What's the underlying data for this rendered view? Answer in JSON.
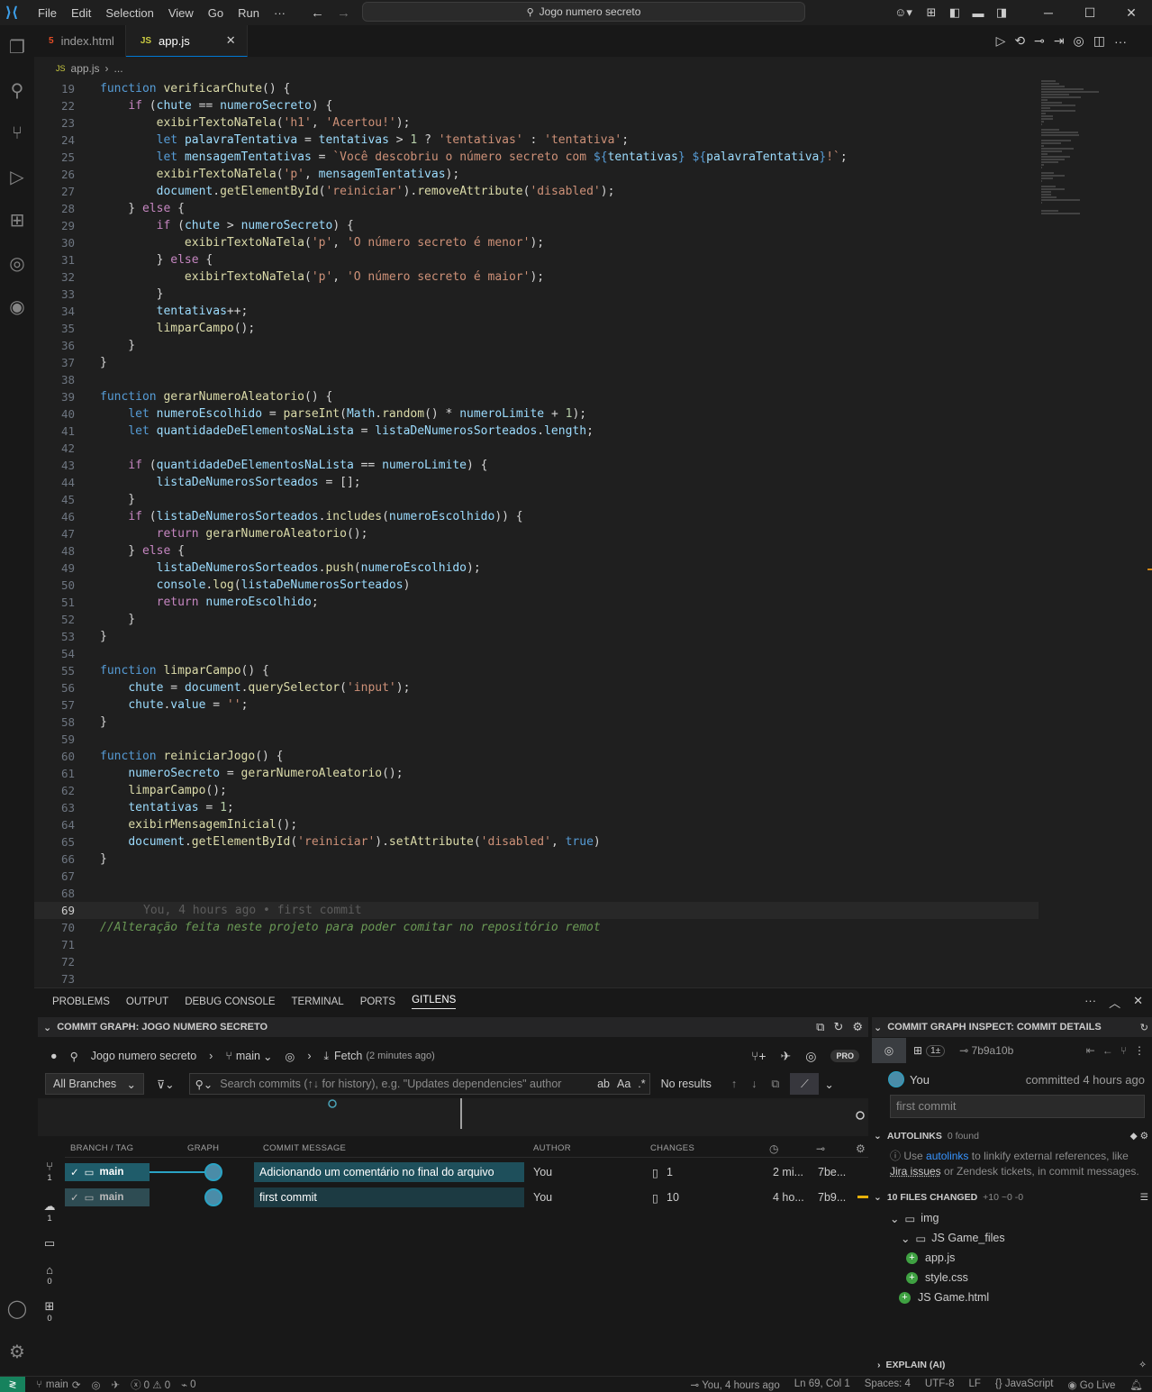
{
  "titlebar": {
    "menu": [
      "File",
      "Edit",
      "Selection",
      "View",
      "Go",
      "Run",
      "···"
    ],
    "search": "Jogo numero secreto"
  },
  "tabs": [
    {
      "label": "index.html",
      "type": "html",
      "active": false
    },
    {
      "label": "app.js",
      "type": "js",
      "active": true
    }
  ],
  "breadcrumb": {
    "file": "app.js",
    "rest": "..."
  },
  "editor": {
    "sticky_line": "19",
    "lines": [
      {
        "n": "19",
        "html": "<span class='kw'>function</span> <span class='fn'>verificarChute</span>() {"
      },
      {
        "n": "22",
        "html": "    <span class='ctl'>if</span> (<span class='var'>chute</span> == <span class='var'>numeroSecreto</span>) {"
      },
      {
        "n": "23",
        "html": "        <span class='fn'>exibirTextoNaTela</span>(<span class='str'>'h1'</span>, <span class='str'>'Acertou!'</span>);"
      },
      {
        "n": "24",
        "html": "        <span class='kw'>let</span> <span class='var'>palavraTentativa</span> = <span class='var'>tentativas</span> &gt; <span class='num'>1</span> ? <span class='str'>'tentativas'</span> : <span class='str'>'tentativa'</span>;"
      },
      {
        "n": "25",
        "html": "        <span class='kw'>let</span> <span class='var'>mensagemTentativas</span> = <span class='str'>`Você descobriu o número secreto com </span><span class='kw'>${</span><span class='var'>tentativas</span><span class='kw'>}</span> <span class='kw'>${</span><span class='var'>palavraTentativa</span><span class='kw'>}</span><span class='str'>!`</span>;"
      },
      {
        "n": "26",
        "html": "        <span class='fn'>exibirTextoNaTela</span>(<span class='str'>'p'</span>, <span class='var'>mensagemTentativas</span>);"
      },
      {
        "n": "27",
        "html": "        <span class='var'>document</span>.<span class='fn'>getElementById</span>(<span class='str'>'reiniciar'</span>).<span class='fn'>removeAttribute</span>(<span class='str'>'disabled'</span>);"
      },
      {
        "n": "28",
        "html": "    } <span class='ctl'>else</span> {"
      },
      {
        "n": "29",
        "html": "        <span class='ctl'>if</span> (<span class='var'>chute</span> &gt; <span class='var'>numeroSecreto</span>) {"
      },
      {
        "n": "30",
        "html": "            <span class='fn'>exibirTextoNaTela</span>(<span class='str'>'p'</span>, <span class='str'>'O número secreto é menor'</span>);"
      },
      {
        "n": "31",
        "html": "        } <span class='ctl'>else</span> {"
      },
      {
        "n": "32",
        "html": "            <span class='fn'>exibirTextoNaTela</span>(<span class='str'>'p'</span>, <span class='str'>'O número secreto é maior'</span>);"
      },
      {
        "n": "33",
        "html": "        }"
      },
      {
        "n": "34",
        "html": "        <span class='var'>tentativas</span>++;"
      },
      {
        "n": "35",
        "html": "        <span class='fn'>limparCampo</span>();"
      },
      {
        "n": "36",
        "html": "    }"
      },
      {
        "n": "37",
        "html": "}"
      },
      {
        "n": "38",
        "html": ""
      },
      {
        "n": "39",
        "html": "<span class='kw'>function</span> <span class='fn'>gerarNumeroAleatorio</span>() {"
      },
      {
        "n": "40",
        "html": "    <span class='kw'>let</span> <span class='var'>numeroEscolhido</span> = <span class='fn'>parseInt</span>(<span class='var'>Math</span>.<span class='fn'>random</span>() * <span class='var'>numeroLimite</span> + <span class='num'>1</span>);"
      },
      {
        "n": "41",
        "html": "    <span class='kw'>let</span> <span class='var'>quantidadeDeElementosNaLista</span> = <span class='var'>listaDeNumerosSorteados</span>.<span class='var'>length</span>;"
      },
      {
        "n": "42",
        "html": ""
      },
      {
        "n": "43",
        "html": "    <span class='ctl'>if</span> (<span class='var'>quantidadeDeElementosNaLista</span> == <span class='var'>numeroLimite</span>) {"
      },
      {
        "n": "44",
        "html": "        <span class='var'>listaDeNumerosSorteados</span> = [];"
      },
      {
        "n": "45",
        "html": "    }"
      },
      {
        "n": "46",
        "html": "    <span class='ctl'>if</span> (<span class='var'>listaDeNumerosSorteados</span>.<span class='fn'>includes</span>(<span class='var'>numeroEscolhido</span>)) {"
      },
      {
        "n": "47",
        "html": "        <span class='ctl'>return</span> <span class='fn'>gerarNumeroAleatorio</span>();"
      },
      {
        "n": "48",
        "html": "    } <span class='ctl'>else</span> {"
      },
      {
        "n": "49",
        "html": "        <span class='var'>listaDeNumerosSorteados</span>.<span class='fn'>push</span>(<span class='var'>numeroEscolhido</span>);"
      },
      {
        "n": "50",
        "html": "        <span class='var'>console</span>.<span class='fn'>log</span>(<span class='var'>listaDeNumerosSorteados</span>)"
      },
      {
        "n": "51",
        "html": "        <span class='ctl'>return</span> <span class='var'>numeroEscolhido</span>;"
      },
      {
        "n": "52",
        "html": "    }"
      },
      {
        "n": "53",
        "html": "}"
      },
      {
        "n": "54",
        "html": ""
      },
      {
        "n": "55",
        "html": "<span class='kw'>function</span> <span class='fn'>limparCampo</span>() {"
      },
      {
        "n": "56",
        "html": "    <span class='var'>chute</span> = <span class='var'>document</span>.<span class='fn'>querySelector</span>(<span class='str'>'input'</span>);"
      },
      {
        "n": "57",
        "html": "    <span class='var'>chute</span>.<span class='var'>value</span> = <span class='str'>''</span>;"
      },
      {
        "n": "58",
        "html": "}"
      },
      {
        "n": "59",
        "html": ""
      },
      {
        "n": "60",
        "html": "<span class='kw'>function</span> <span class='fn'>reiniciarJogo</span>() {"
      },
      {
        "n": "61",
        "html": "    <span class='var'>numeroSecreto</span> = <span class='fn'>gerarNumeroAleatorio</span>();"
      },
      {
        "n": "62",
        "html": "    <span class='fn'>limparCampo</span>();"
      },
      {
        "n": "63",
        "html": "    <span class='var'>tentativas</span> = <span class='num'>1</span>;"
      },
      {
        "n": "64",
        "html": "    <span class='fn'>exibirMensagemInicial</span>();"
      },
      {
        "n": "65",
        "html": "    <span class='var'>document</span>.<span class='fn'>getElementById</span>(<span class='str'>'reiniciar'</span>).<span class='fn'>setAttribute</span>(<span class='str'>'disabled'</span>, <span class='kw'>true</span>)"
      },
      {
        "n": "66",
        "html": "}"
      },
      {
        "n": "67",
        "html": ""
      },
      {
        "n": "68",
        "html": ""
      },
      {
        "n": "69",
        "html": "<span class='blame'>You, 4 hours ago • first commit</span>",
        "current": true
      },
      {
        "n": "70",
        "html": "<span class='cm'>//Alteração feita neste projeto para poder comitar no repositório remot</span>"
      },
      {
        "n": "71",
        "html": ""
      },
      {
        "n": "72",
        "html": ""
      },
      {
        "n": "73",
        "html": ""
      }
    ]
  },
  "panel": {
    "tabs": [
      "PROBLEMS",
      "OUTPUT",
      "DEBUG CONSOLE",
      "TERMINAL",
      "PORTS",
      "GITLENS"
    ],
    "active_tab": "GITLENS",
    "graph_title": "COMMIT GRAPH: JOGO NUMERO SECRETO",
    "repo": "Jogo numero secreto",
    "branch": "main",
    "fetch": "Fetch",
    "fetch_time": "(2 minutes ago)",
    "pro": "PRO",
    "branches_select": "All Branches",
    "search_placeholder": "Search commits (↑↓ for history), e.g. \"Updates dependencies\" author",
    "no_results": "No results",
    "columns": {
      "branch": "BRANCH / TAG",
      "graph": "GRAPH",
      "message": "COMMIT MESSAGE",
      "author": "AUTHOR",
      "changes": "CHANGES"
    },
    "rail_counts": [
      "1",
      "1",
      "0",
      "0"
    ],
    "commits": [
      {
        "branch": "main",
        "message": "Adicionando um comentário no final do arquivo",
        "author": "You",
        "changes": "1",
        "time": "2 mi...",
        "sha": "7be..."
      },
      {
        "branch": "main",
        "message": "first commit",
        "author": "You",
        "changes": "10",
        "time": "4 ho...",
        "sha": "7b9..."
      }
    ]
  },
  "inspect": {
    "title": "COMMIT GRAPH INSPECT: COMMIT DETAILS",
    "pill": "1±",
    "sha": "7b9a10b",
    "author": "You",
    "committed": "committed 4 hours ago",
    "message": "first commit",
    "autolinks_title": "AUTOLINKS",
    "autolinks_found": "0 found",
    "autolinks_text_1": "Use",
    "autolinks_link": "autolinks",
    "autolinks_text_2": "to linkify external references, like",
    "autolinks_jira": "Jira issues",
    "autolinks_text_3": "or Zendesk tickets, in commit messages.",
    "files_title": "10 FILES CHANGED",
    "files_stats": "+10  ~0  -0",
    "tree": [
      {
        "label": "img",
        "kind": "folder",
        "depth": 0
      },
      {
        "label": "JS Game_files",
        "kind": "folder",
        "depth": 1
      },
      {
        "label": "app.js",
        "kind": "file",
        "depth": 2
      },
      {
        "label": "style.css",
        "kind": "file",
        "depth": 2
      },
      {
        "label": "JS Game.html",
        "kind": "file",
        "depth": 1
      }
    ],
    "explain": "EXPLAIN (AI)"
  },
  "statusbar": {
    "branch": "main",
    "problems": "0 ⚠ 0",
    "ports": "0",
    "blame": "You, 4 hours ago",
    "position": "Ln 69, Col 1",
    "spaces": "Spaces: 4",
    "encoding": "UTF-8",
    "eol": "LF",
    "language": "JavaScript",
    "golive": "Go Live"
  },
  "colors": {
    "accent": "#0078d4",
    "remote": "#16825d",
    "branch_chip": "#1f5c6a"
  }
}
